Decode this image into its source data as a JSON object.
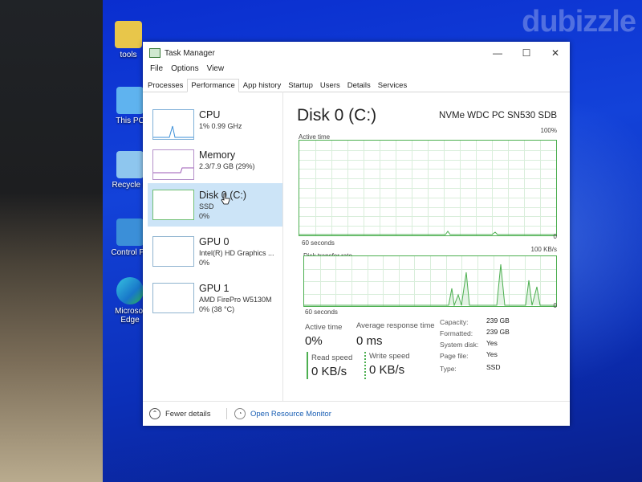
{
  "watermark": "dubizzle",
  "desktop_icons": [
    {
      "label": "tools"
    },
    {
      "label": "This PC"
    },
    {
      "label": "Recycle B"
    },
    {
      "label": "Control Pa"
    },
    {
      "label": "Microsof\nEdge"
    }
  ],
  "window": {
    "title": "Task Manager",
    "controls": {
      "minimize": "—",
      "maximize": "☐",
      "close": "✕"
    }
  },
  "menu": [
    "File",
    "Options",
    "View"
  ],
  "tabs": [
    {
      "label": "Processes",
      "active": false
    },
    {
      "label": "Performance",
      "active": true
    },
    {
      "label": "App history",
      "active": false
    },
    {
      "label": "Startup",
      "active": false
    },
    {
      "label": "Users",
      "active": false
    },
    {
      "label": "Details",
      "active": false
    },
    {
      "label": "Services",
      "active": false
    }
  ],
  "sidebar": [
    {
      "title": "CPU",
      "line1": "1% 0.99 GHz",
      "line2": ""
    },
    {
      "title": "Memory",
      "line1": "2.3/7.9 GB (29%)",
      "line2": ""
    },
    {
      "title": "Disk 0 (C:)",
      "line1": "SSD",
      "line2": "0%"
    },
    {
      "title": "GPU 0",
      "line1": "Intel(R) HD Graphics ...",
      "line2": "0%"
    },
    {
      "title": "GPU 1",
      "line1": "AMD FirePro W5130M",
      "line2": "0% (38 °C)"
    }
  ],
  "main": {
    "title": "Disk 0 (C:)",
    "model": "NVMe WDC PC SN530 SDB",
    "active_time_label": "Active time",
    "active_time_max": "100%",
    "active_time_seconds": "60 seconds",
    "active_time_min": "0",
    "transfer_label": "Disk transfer rate",
    "transfer_max": "100 KB/s",
    "transfer_seconds": "60 seconds",
    "transfer_min": "0",
    "stats": {
      "active_time_label": "Active time",
      "active_time_value": "0%",
      "avg_response_label": "Average response time",
      "avg_response_value": "0 ms",
      "read_label": "Read speed",
      "read_value": "0 KB/s",
      "write_label": "Write speed",
      "write_value": "0 KB/s"
    },
    "properties": [
      {
        "label": "Capacity:",
        "value": "239 GB"
      },
      {
        "label": "Formatted:",
        "value": "239 GB"
      },
      {
        "label": "System disk:",
        "value": "Yes"
      },
      {
        "label": "Page file:",
        "value": "Yes"
      },
      {
        "label": "Type:",
        "value": "SSD"
      }
    ]
  },
  "footer": {
    "fewer_details": "Fewer details",
    "open_resource_monitor": "Open Resource Monitor"
  },
  "colors": {
    "accent": "#1a5fb4",
    "graph_line": "#4caf50",
    "selected": "#cce4f7",
    "desktop": "#1342d9"
  }
}
